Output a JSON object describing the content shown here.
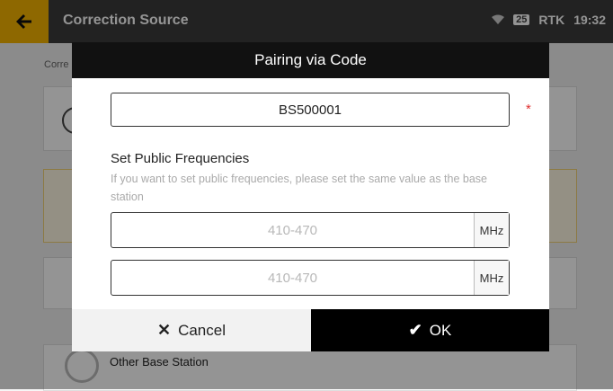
{
  "topbar": {
    "back_icon": "arrow-left-icon",
    "title": "Correction Source",
    "status": {
      "wifi_icon": "wifi-icon",
      "signal": "25",
      "rtk_label": "RTK",
      "time": "19:32"
    },
    "accent": "#f4b300"
  },
  "background": {
    "breadcrumb": "Corre",
    "other_label": "Other Base Station"
  },
  "dialog": {
    "title": "Pairing via Code",
    "code_value": "BS500001",
    "required_mark": "*",
    "section_title": "Set Public Frequencies",
    "hint": "If you want to set public frequencies, please set the same value as the base station",
    "frequencies": [
      {
        "placeholder": "410-470",
        "unit": "MHz"
      },
      {
        "placeholder": "410-470",
        "unit": "MHz"
      }
    ],
    "cancel_label": "Cancel",
    "ok_label": "OK"
  }
}
